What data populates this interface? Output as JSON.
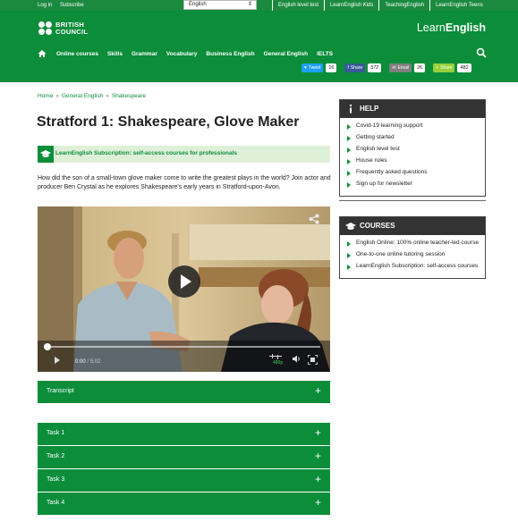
{
  "topbar": {
    "login": "Log in",
    "subscribe": "Subscribe",
    "language": "English",
    "sites": [
      "English level test",
      "LearnEnglish Kids",
      "TeachingEnglish",
      "LearnEnglish Teens"
    ]
  },
  "header": {
    "logo_line1": "BRITISH",
    "logo_line2": "COUNCIL",
    "brand_light": "Learn",
    "brand_bold": "English",
    "nav": [
      "Online courses",
      "Skills",
      "Grammar",
      "Vocabulary",
      "Business English",
      "General English",
      "IELTS"
    ],
    "share": [
      {
        "label": "Tweet",
        "icon": "twitter-icon",
        "count": "16",
        "color": "#1da1f2"
      },
      {
        "label": "Share",
        "icon": "facebook-icon",
        "count": "372",
        "color": "#3b5998"
      },
      {
        "label": "Email",
        "icon": "email-icon",
        "count": "26",
        "color": "#7f7f7f"
      },
      {
        "label": "Share",
        "icon": "share-icon",
        "count": "482",
        "color": "#95d03a"
      }
    ]
  },
  "breadcrumb": [
    "Home",
    "General English",
    "Shakespeare"
  ],
  "breadcrumb_sep": "»",
  "page": {
    "title": "Stratford 1: Shakespeare, Glove Maker",
    "subscription_banner": "LearnEnglish Subscription: self-access courses for professionals",
    "intro": "How did the son of a small-town glove maker come to write the greatest plays in the world? Join actor and producer Ben Crystal as he explores Shakespeare's early years in Stratford-upon-Avon."
  },
  "video": {
    "current_time": "0:00",
    "duration": "/ 5:02",
    "quality": "480p",
    "progress": 0
  },
  "accordion": [
    "Transcript",
    "Task 1",
    "Task 2",
    "Task 3",
    "Task 4"
  ],
  "accordion_plus": "+",
  "help": {
    "title": "HELP",
    "items": [
      "Covid-19 learning support",
      "Getting started",
      "English level test",
      "House rules",
      "Frequently asked questions",
      "Sign up for newsletter"
    ]
  },
  "courses": {
    "title": "COURSES",
    "items": [
      "English Online: 100% online teacher-led course",
      "One-to-one online tutoring session",
      "LearnEnglish Subscription: self-access courses"
    ]
  },
  "colors": {
    "brand_green": "#0b8d3a",
    "banner_bg": "#dff0d8",
    "sidebar_head": "#333333"
  }
}
